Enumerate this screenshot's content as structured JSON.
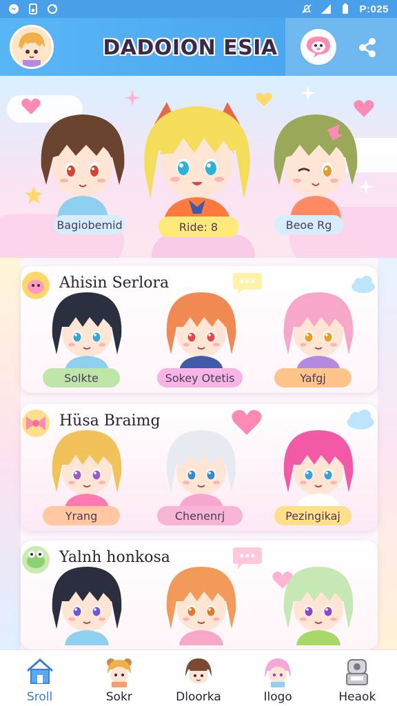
{
  "status_bar": {
    "time": "P:025"
  },
  "header": {
    "title": "DADOION ESIA"
  },
  "hero": {
    "characters": [
      {
        "name": "Bagiobemid",
        "hair": "#6b4430",
        "eyes": "#d9442e",
        "outfit": "#8fd0f0",
        "pill": "#d6eefc"
      },
      {
        "name": "Ride: 8",
        "hair": "#f5dd5c",
        "eyes": "#2fb0d8",
        "outfit": "#ff7a3c",
        "pill": "#ffe97a"
      },
      {
        "name": "Beoe Rg",
        "hair": "#9aa85a",
        "eyes": "#e59a2e",
        "outfit": "#ff8a64",
        "pill": "#d6eefc"
      }
    ]
  },
  "sections": [
    {
      "title": "Ahisin Serlora",
      "characters": [
        {
          "name": "Solkte",
          "hair": "#2b3040",
          "eyes": "#3aa6d8",
          "outfit": "#8fd0f0",
          "pill": "#bfe6a8"
        },
        {
          "name": "Sokey Otetis",
          "hair": "#f08a52",
          "eyes": "#e04a4a",
          "outfit": "#3e5aa8",
          "pill": "#f6b5e4"
        },
        {
          "name": "Yafgj",
          "hair": "#f7a8c8",
          "eyes": "#e8a02a",
          "outfit": "#b48ae0",
          "pill": "#ffc48a"
        }
      ]
    },
    {
      "title": "Hüsa Braimg",
      "characters": [
        {
          "name": "Yrang",
          "hair": "#f2c25a",
          "eyes": "#9b5cc8",
          "outfit": "#ff7ab0",
          "pill": "#ffc8a0"
        },
        {
          "name": "Chenenrj",
          "hair": "#e8eaf2",
          "eyes": "#3a8ad0",
          "outfit": "#f6a8d0",
          "pill": "#f8b4d4"
        },
        {
          "name": "Pezingikaj",
          "hair": "#f25aa8",
          "eyes": "#3aa0d8",
          "outfit": "#ffffff",
          "pill": "#ffe08a"
        }
      ]
    },
    {
      "title": "Yalnh honkosa",
      "characters": [
        {
          "name": "",
          "hair": "#2a2e3e",
          "eyes": "#6a5ad8",
          "outfit": "#8fd0f0",
          "pill": "#d6eefc"
        },
        {
          "name": "",
          "hair": "#f29a5a",
          "eyes": "#e0782e",
          "outfit": "#f6a8c8",
          "pill": "#f6b5e4"
        },
        {
          "name": "",
          "hair": "#c6e8b4",
          "eyes": "#8a4ac8",
          "outfit": "#a8d868",
          "pill": "#d6eefc"
        }
      ]
    }
  ],
  "bottom_nav": [
    {
      "label": "Sroll",
      "icon": "home-icon",
      "active": true
    },
    {
      "label": "Sokr",
      "icon": "bear-avatar-icon",
      "active": false
    },
    {
      "label": "Dloorka",
      "icon": "brown-hair-avatar-icon",
      "active": false
    },
    {
      "label": "Ilogo",
      "icon": "pink-hair-avatar-icon",
      "active": false
    },
    {
      "label": "Heaok",
      "icon": "robot-icon",
      "active": false
    }
  ],
  "colors": {
    "primary": "#4aa0e8",
    "accent": "#ff7ab0",
    "nav_active": "#3a7fd0"
  }
}
